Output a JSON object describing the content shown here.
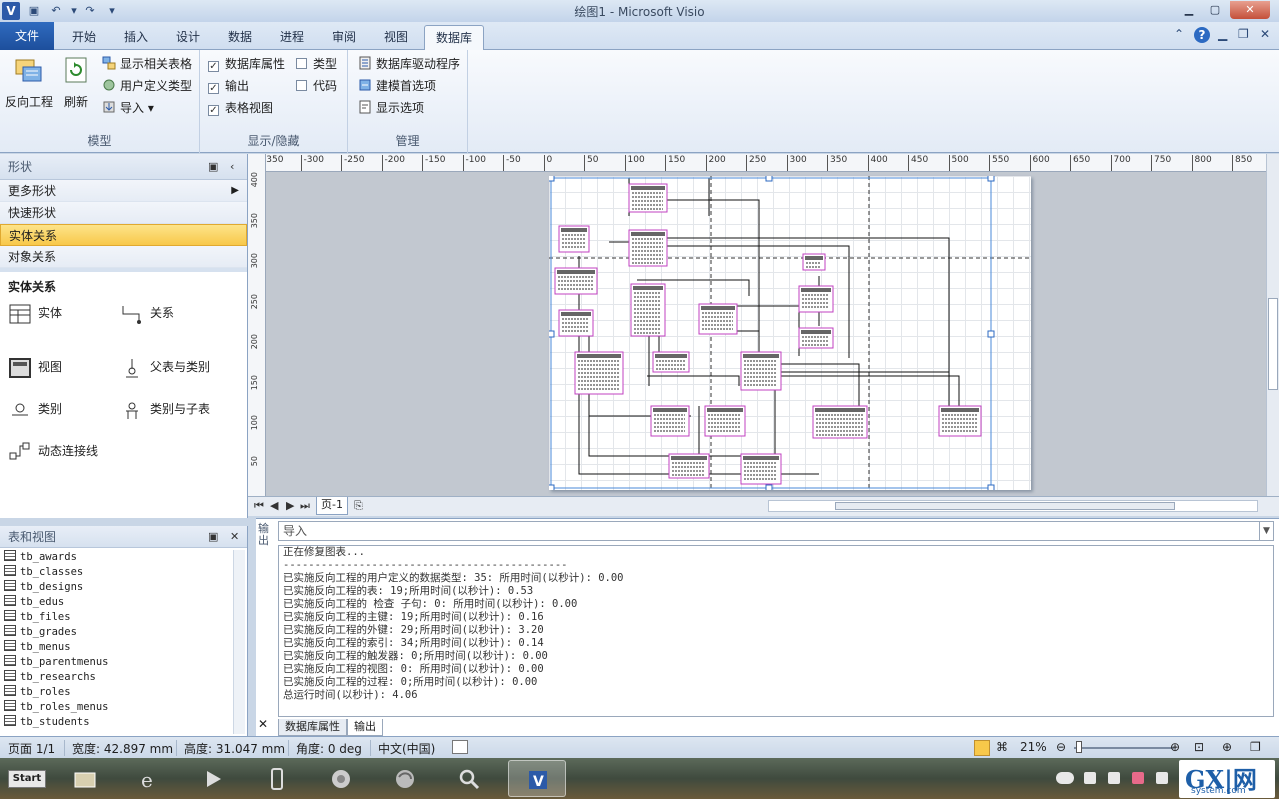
{
  "window": {
    "title": "绘图1 - Microsoft Visio"
  },
  "tabs": [
    "文件",
    "开始",
    "插入",
    "设计",
    "数据",
    "进程",
    "审阅",
    "视图",
    "数据库"
  ],
  "ribbon": {
    "model_group": {
      "label": "模型",
      "reverse_engineer": "反向工程",
      "refresh": "刷新",
      "show_related_tables": "显示相关表格",
      "user_defined_types": "用户定义类型",
      "import": "导入"
    },
    "showhide_group": {
      "label": "显示/隐藏",
      "db_properties": "数据库属性",
      "output": "输出",
      "table_view": "表格视图",
      "types": "类型",
      "code": "代码"
    },
    "manage_group": {
      "label": "管理",
      "db_drivers": "数据库驱动程序",
      "modeling_prefs": "建模首选项",
      "display_options": "显示选项"
    }
  },
  "shapes_pane": {
    "title": "形状",
    "stencils": [
      "更多形状",
      "快速形状",
      "实体关系",
      "对象关系"
    ],
    "section_title": "实体关系",
    "items": [
      "实体",
      "关系",
      "视图",
      "父表与类别",
      "类别",
      "类别与子表",
      "动态连接线"
    ]
  },
  "table_view": {
    "title": "表和视图",
    "tables": [
      "tb_awards",
      "tb_classes",
      "tb_designs",
      "tb_edus",
      "tb_files",
      "tb_grades",
      "tb_menus",
      "tb_parentmenus",
      "tb_researchs",
      "tb_roles",
      "tb_roles_menus",
      "tb_students"
    ]
  },
  "drawing": {
    "ruler_top": [
      "-350",
      "-300",
      "-250",
      "-200",
      "-150",
      "-100",
      "-50",
      "0",
      "50",
      "100",
      "150",
      "200",
      "250",
      "300",
      "350",
      "400",
      "450",
      "500",
      "550",
      "600",
      "650",
      "700",
      "750",
      "800",
      "850"
    ],
    "ruler_left": [
      "400",
      "350",
      "300",
      "250",
      "200",
      "150",
      "100",
      "50"
    ],
    "page_tab": "页-1"
  },
  "output_window": {
    "side_label": "输出",
    "combo_value": "导入",
    "lines": [
      "正在修复图表...",
      "---------------------------------------------",
      "已实施反向工程的用户定义的数据类型: 35: 所用时间(以秒计): 0.00",
      "已实施反向工程的表: 19;所用时间(以秒计): 0.53",
      "已实施反向工程的 检查 子句: 0: 所用时间(以秒计): 0.00",
      "已实施反向工程的主键: 19;所用时间(以秒计): 0.16",
      "已实施反向工程的外键: 29;所用时间(以秒计): 3.20",
      "已实施反向工程的索引: 34;所用时间(以秒计): 0.14",
      "已实施反向工程的触发器: 0;所用时间(以秒计): 0.00",
      "已实施反向工程的视图: 0: 所用时间(以秒计): 0.00",
      "已实施反向工程的过程: 0;所用时间(以秒计): 0.00",
      "总运行时间(以秒计): 4.06"
    ],
    "tabs": [
      "数据库属性",
      "输出"
    ]
  },
  "status": {
    "page": "页面 1/1",
    "width": "宽度: 42.897 mm",
    "height": "高度: 31.047 mm",
    "angle": "角度: 0 deg",
    "language": "中文(中国)",
    "zoom": "21%"
  },
  "taskbar": {
    "start": "Start"
  },
  "watermark": {
    "brand": "GX|网",
    "site": "system.com"
  },
  "colors": {
    "accent": "#1d4f9c",
    "selected_stencil": "#f8c84a",
    "entity_border": "#c040c0"
  }
}
